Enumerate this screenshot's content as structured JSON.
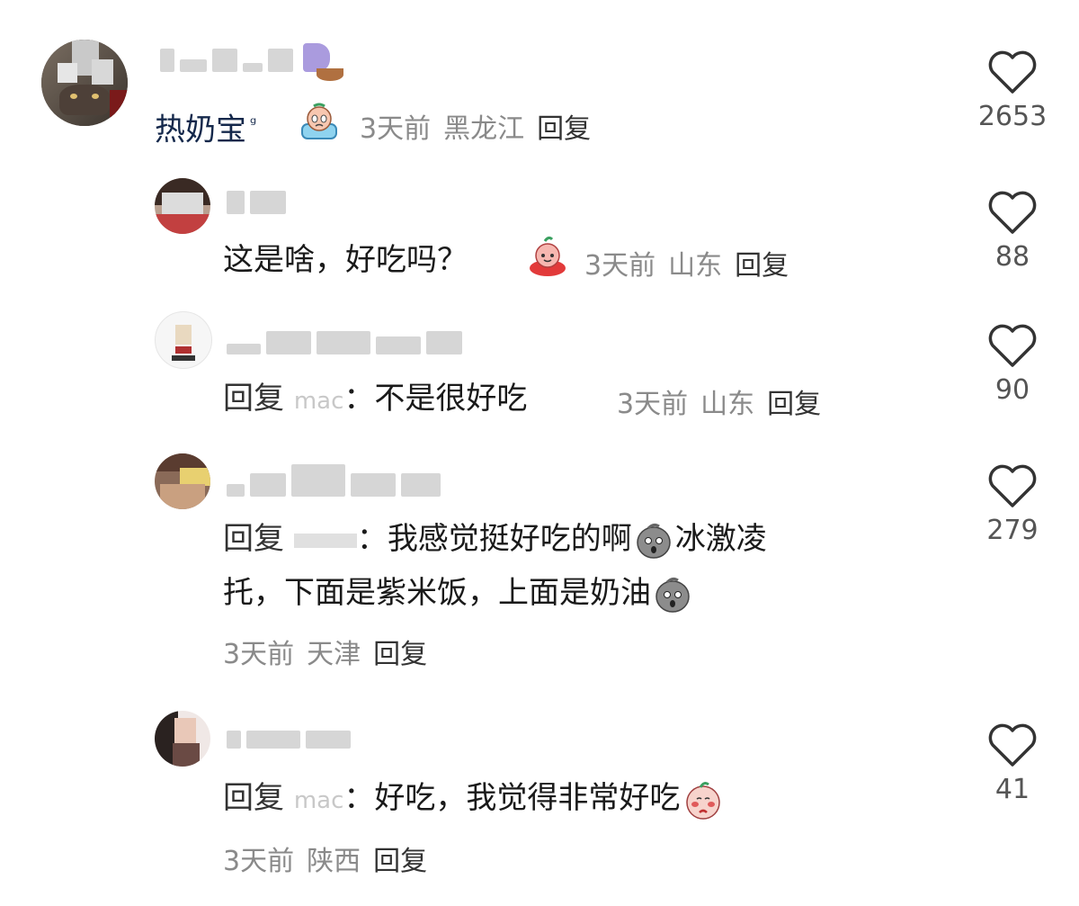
{
  "comments": [
    {
      "text": "热奶宝",
      "search_mark": "ᵍ",
      "time": "3天前",
      "location": "黑龙江",
      "reply_label": "回复",
      "likes": "2653"
    },
    {
      "text": "这是啥，好吃吗？",
      "time": "3天前",
      "location": "山东",
      "reply_label": "回复",
      "likes": "88"
    },
    {
      "reply_prefix": "回复",
      "reply_target": "mac",
      "text": "不是很好吃",
      "time": "3天前",
      "location": "山东",
      "reply_label": "回复",
      "likes": "90"
    },
    {
      "reply_prefix": "回复",
      "reply_target": "",
      "text_line1_a": "我感觉挺好吃的啊",
      "text_line1_b": "冰激凌",
      "text_line2": "托，下面是紫米饭，上面是奶油",
      "time": "3天前",
      "location": "天津",
      "reply_label": "回复",
      "likes": "279"
    },
    {
      "reply_prefix": "回复",
      "reply_target": "mac",
      "text": "好吃，我觉得非常好吃",
      "time": "3天前",
      "location": "陕西",
      "reply_label": "回复",
      "likes": "41"
    }
  ],
  "colors": {
    "meta": "#8a8a8a",
    "text": "#1a1a1a",
    "heart": "#333333"
  },
  "icons": {
    "like": "heart-outline-icon"
  }
}
